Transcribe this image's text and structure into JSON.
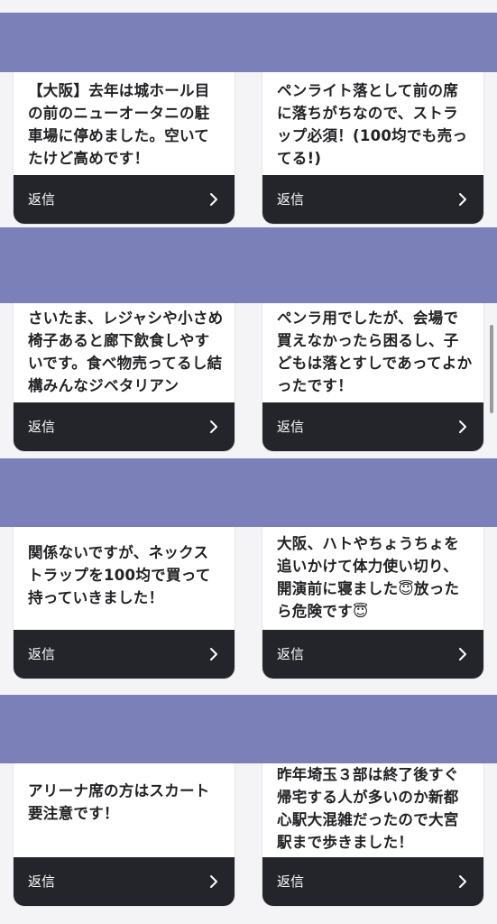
{
  "reply_label": "返信",
  "icons": {
    "reply_chevron": "chevron-right-icon"
  },
  "colors": {
    "banner": "#7b80b9",
    "reply_bar": "#24252a",
    "card": "#ffffff",
    "page_bg": "#f4f4f6",
    "text": "#222226"
  },
  "cards": [
    {
      "text": "【大阪】去年は城ホール目の前のニューオータニの駐車場に停めました。空いてたけど高めです！"
    },
    {
      "text": "ペンライト落として前の席に落ちがちなので、ストラップ必須！(100均でも売ってる!)"
    },
    {
      "text": "さいたま、レジャシや小さめ椅子あると廊下飲食しやすいです。食べ物売ってるし結構みんなジベタリアン"
    },
    {
      "text": "ペンラ用でしたが、会場で買えなかったら困るし、子どもは落とすしであってよかったです！"
    },
    {
      "text": "関係ないですが、ネックストラップを100均で買って持っていきました！"
    },
    {
      "text": "大阪、ハトやちょうちょを追いかけて体力使い切り、開演前に寝ました😇放ったら危険です😇"
    },
    {
      "text": "アリーナ席の方はスカート要注意です！"
    },
    {
      "text": "昨年埼玉３部は終了後すぐ帰宅する人が多いのか新都心駅大混雑だったので大宮駅まで歩きました！"
    }
  ]
}
